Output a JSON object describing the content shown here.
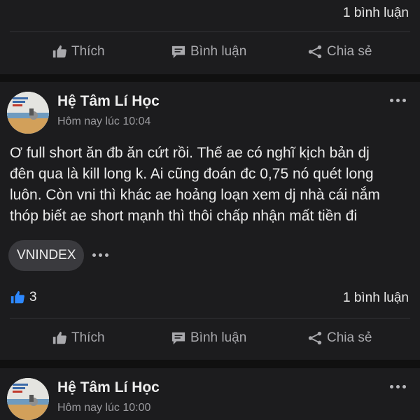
{
  "top_post": {
    "comment_count": "1 bình luận",
    "actions": {
      "like": "Thích",
      "comment": "Bình luận",
      "share": "Chia sẻ"
    }
  },
  "main_post": {
    "author": "Hệ Tâm Lí Học",
    "timestamp": "Hôm nay lúc 10:04",
    "text_lines": [
      "Ơ full short ăn đb ăn cứt rồi. Thế ae có nghĩ kịch bản dj",
      "đên qua là kill long k. Ai cũng đoán đc 0,75 nó quét long",
      "luôn. Còn vni thì khác ae hoảng loạn xem dj nhà cái nắm",
      "thóp biết ae short mạnh thì thôi chấp nhận mất tiền đi"
    ],
    "tag": "VNINDEX",
    "like_count": "3",
    "comment_count": "1 bình luận",
    "actions": {
      "like": "Thích",
      "comment": "Bình luận",
      "share": "Chia sẻ"
    }
  },
  "next_post": {
    "author": "Hệ Tâm Lí Học",
    "timestamp": "Hôm nay lúc 10:00"
  },
  "colors": {
    "background": "#101010",
    "card": "#1c1c1e",
    "like_icon": "#2d88ff",
    "muted_text": "#a9a9ad"
  },
  "icons": {
    "like": "thumbs-up-icon",
    "comment": "comment-bubble-icon",
    "share": "share-icon",
    "more": "more-dots-icon"
  }
}
